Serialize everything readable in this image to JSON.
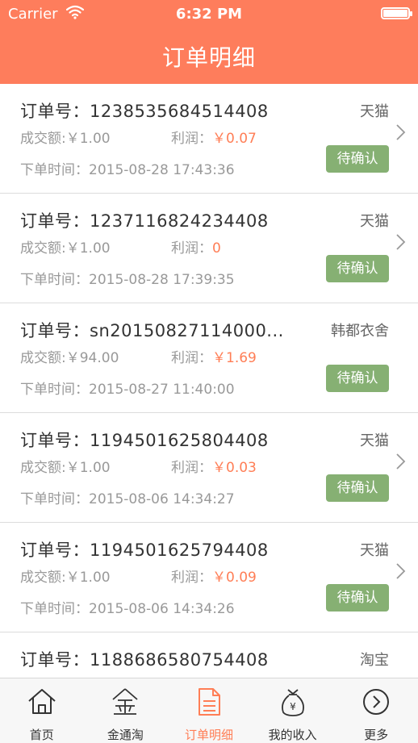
{
  "status_bar": {
    "carrier": "Carrier",
    "time": "6:32 PM"
  },
  "header": {
    "title": "订单明细"
  },
  "labels": {
    "order_no": "订单号：",
    "amount": "成交额:",
    "profit": "利润：",
    "time": "下单时间：",
    "currency": "￥"
  },
  "orders": [
    {
      "order_no": "1238535684514408",
      "shop": "天猫",
      "amount": "1.00",
      "profit": "￥0.07",
      "time": "2015-08-28 17:43:36",
      "status": "待确认",
      "has_chevron": true
    },
    {
      "order_no": "1237116824234408",
      "shop": "天猫",
      "amount": "1.00",
      "profit": "0",
      "time": "2015-08-28 17:39:35",
      "status": "待确认",
      "has_chevron": true
    },
    {
      "order_no": "sn20150827114000...",
      "shop": "韩都衣舍",
      "amount": "94.00",
      "profit": "￥1.69",
      "time": "2015-08-27 11:40:00",
      "status": "待确认",
      "has_chevron": false
    },
    {
      "order_no": "1194501625804408",
      "shop": "天猫",
      "amount": "1.00",
      "profit": "￥0.03",
      "time": "2015-08-06 14:34:27",
      "status": "待确认",
      "has_chevron": true
    },
    {
      "order_no": "1194501625794408",
      "shop": "天猫",
      "amount": "1.00",
      "profit": "￥0.09",
      "time": "2015-08-06 14:34:26",
      "status": "待确认",
      "has_chevron": true
    },
    {
      "order_no": "1188686580754408",
      "shop": "淘宝",
      "amount": "",
      "profit": "",
      "time": "",
      "status": "",
      "has_chevron": false
    }
  ],
  "tabs": [
    {
      "label": "首页",
      "icon": "home-icon",
      "active": false
    },
    {
      "label": "金通淘",
      "icon": "gold-icon",
      "active": false
    },
    {
      "label": "订单明细",
      "icon": "document-icon",
      "active": true
    },
    {
      "label": "我的收入",
      "icon": "money-bag-icon",
      "active": false
    },
    {
      "label": "更多",
      "icon": "more-circle-icon",
      "active": false
    }
  ],
  "colors": {
    "header": "#fe7d5c",
    "accent": "#ff7e56",
    "badge": "#86b073"
  }
}
